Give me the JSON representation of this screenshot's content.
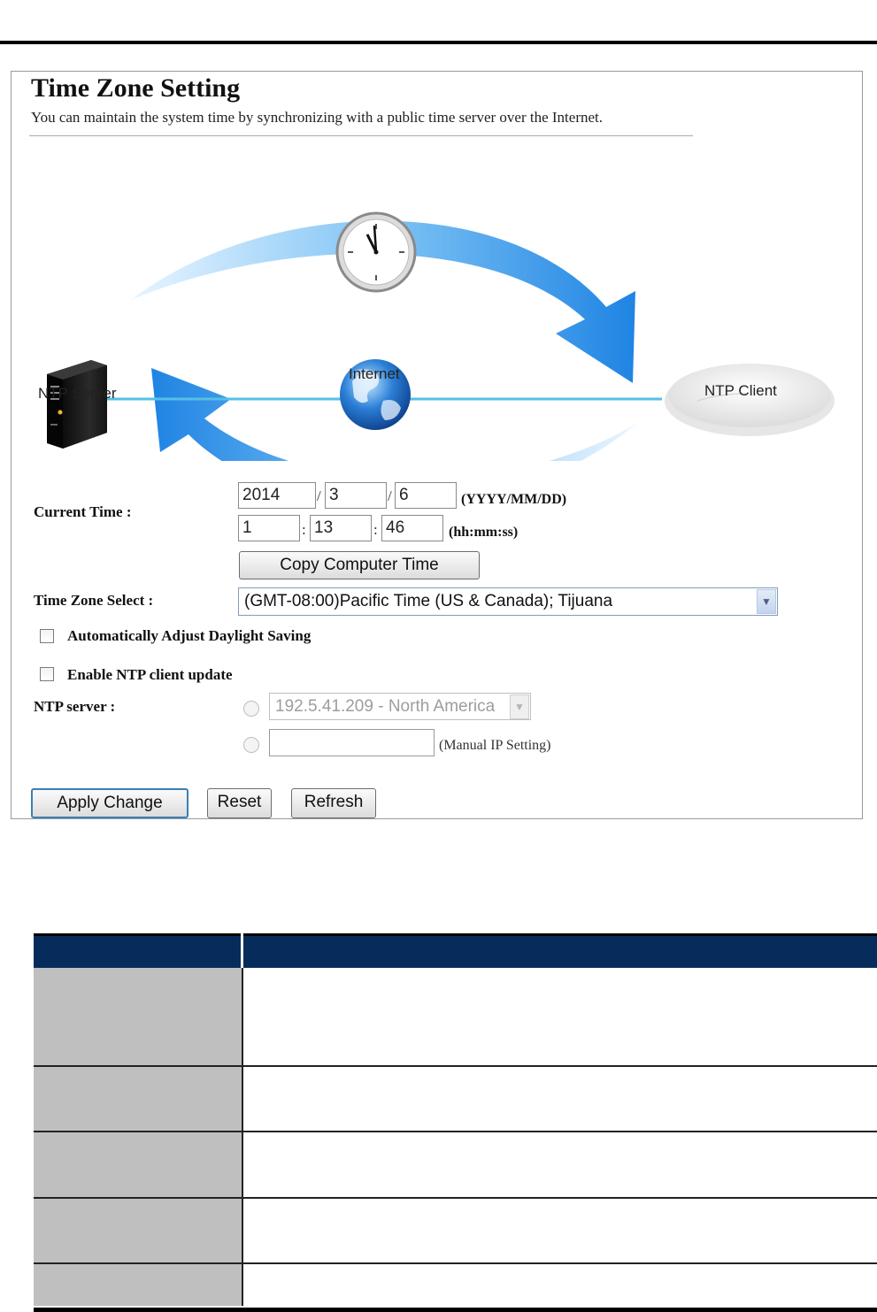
{
  "page": {
    "title": "Time Zone Setting",
    "subtitle": "You can maintain the system time by synchronizing with a public time server over the Internet."
  },
  "diagram": {
    "ntp_server_label": "NTP Server",
    "internet_label": "Internet",
    "ntp_client_label": "NTP Client",
    "clock_icon": "clock-icon",
    "globe_icon": "globe-icon",
    "server_icon": "server-tower-icon",
    "client_icon": "access-point-icon"
  },
  "form": {
    "current_time_label": "Current Time :",
    "year": "2014",
    "month": "3",
    "day": "6",
    "date_sep": "/",
    "date_format": "(YYYY/MM/DD)",
    "hour": "1",
    "minute": "13",
    "second": "46",
    "time_sep": ":",
    "time_format": "(hh:mm:ss)",
    "copy_button": "Copy Computer Time",
    "timezone_label": "Time Zone Select :",
    "timezone_value": "(GMT-08:00)Pacific Time (US & Canada); Tijuana",
    "daylight_label": "Automatically Adjust Daylight Saving",
    "daylight_checked": false,
    "ntp_enable_label": "Enable NTP client update",
    "ntp_enable_checked": false,
    "ntp_server_label": "NTP server :",
    "ntp_server_value": "192.5.41.209 - North America",
    "manual_ip_value": "",
    "manual_ip_label": "(Manual IP Setting)"
  },
  "buttons": {
    "apply": "Apply Change",
    "reset": "Reset",
    "refresh": "Refresh"
  },
  "colors": {
    "table_header": "#062c5c",
    "table_label_cell": "#bfbfbf",
    "arrow_blue": "#3a97ea",
    "link_line": "#56bfe6",
    "button_focus_border": "#3c7fb1"
  },
  "table": {
    "headers": [
      "",
      ""
    ],
    "rows": [
      [
        "",
        ""
      ],
      [
        "",
        ""
      ],
      [
        "",
        ""
      ],
      [
        "",
        ""
      ],
      [
        "",
        ""
      ]
    ]
  }
}
